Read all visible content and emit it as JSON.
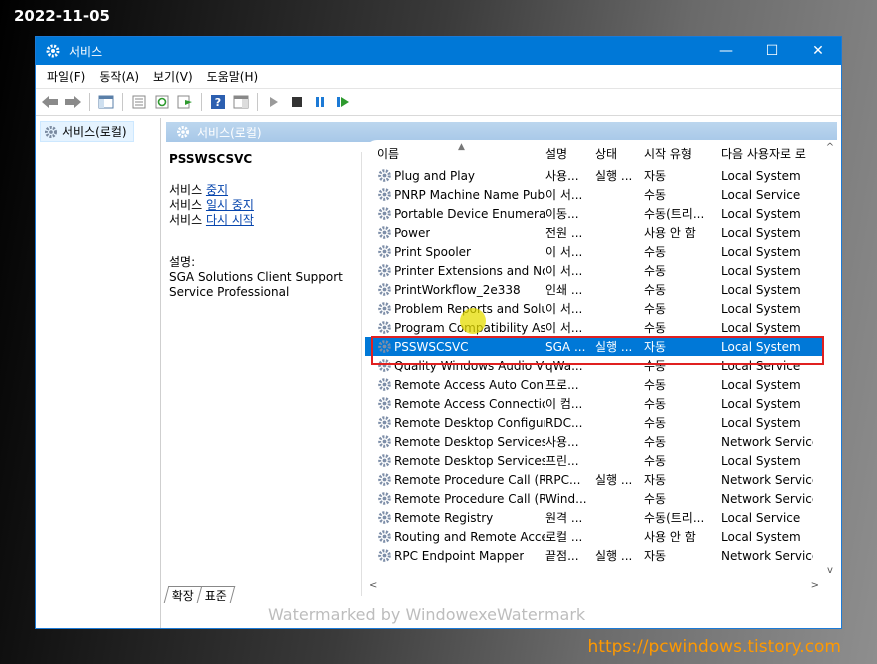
{
  "date_stamp": "2022-11-05",
  "site_url": "https://pcwindows.tistory.com",
  "watermark": "Watermarked by WindowexeWatermark",
  "window": {
    "title": "서비스",
    "controls": {
      "minimize": "—",
      "maximize": "☐",
      "close": "✕"
    }
  },
  "menu": [
    "파일(F)",
    "동작(A)",
    "보기(V)",
    "도움말(H)"
  ],
  "tree": {
    "root_label": "서비스(로컬)"
  },
  "pane": {
    "header": "서비스(로컬)",
    "selected_service": "PSSWSCSVC",
    "actions": [
      {
        "prefix": "서비스 ",
        "link": "중지"
      },
      {
        "prefix": "서비스 ",
        "link": "일시 중지"
      },
      {
        "prefix": "서비스 ",
        "link": "다시 시작"
      }
    ],
    "desc_label": "설명:",
    "desc_lines": [
      "SGA Solutions Client Support",
      "Service Professional"
    ]
  },
  "columns": {
    "name": "이름",
    "desc": "설명",
    "status": "상태",
    "start": "시작 유형",
    "logon": "다음 사용자로 로"
  },
  "rows": [
    {
      "name": "Plug and Play",
      "desc": "사용...",
      "status": "실행 ...",
      "start": "자동",
      "logon": "Local System"
    },
    {
      "name": "PNRP Machine Name Publi...",
      "desc": "이 서...",
      "status": "",
      "start": "수동",
      "logon": "Local Service"
    },
    {
      "name": "Portable Device Enumerato...",
      "desc": "이동...",
      "status": "",
      "start": "수동(트리...",
      "logon": "Local System"
    },
    {
      "name": "Power",
      "desc": "전원 ...",
      "status": "",
      "start": "사용 안 함",
      "logon": "Local System"
    },
    {
      "name": "Print Spooler",
      "desc": "이 서...",
      "status": "",
      "start": "수동",
      "logon": "Local System"
    },
    {
      "name": "Printer Extensions and Noti...",
      "desc": "이 서...",
      "status": "",
      "start": "수동",
      "logon": "Local System"
    },
    {
      "name": "PrintWorkflow_2e338",
      "desc": "인쇄 ...",
      "status": "",
      "start": "수동",
      "logon": "Local System"
    },
    {
      "name": "Problem Reports and Solut...",
      "desc": "이 서...",
      "status": "",
      "start": "수동",
      "logon": "Local System"
    },
    {
      "name": "Program Compatibility Assi...",
      "desc": "이 서...",
      "status": "",
      "start": "수동",
      "logon": "Local System"
    },
    {
      "name": "PSSWSCSVC",
      "desc": "SGA ...",
      "status": "실행 ...",
      "start": "자동",
      "logon": "Local System",
      "selected": true
    },
    {
      "name": "Quality Windows Audio Vi...",
      "desc": "qWa...",
      "status": "",
      "start": "수동",
      "logon": "Local Service"
    },
    {
      "name": "Remote Access Auto Conn...",
      "desc": "프로...",
      "status": "",
      "start": "수동",
      "logon": "Local System"
    },
    {
      "name": "Remote Access Connection...",
      "desc": "이 컴...",
      "status": "",
      "start": "수동",
      "logon": "Local System"
    },
    {
      "name": "Remote Desktop Configura...",
      "desc": "RDC...",
      "status": "",
      "start": "수동",
      "logon": "Local System"
    },
    {
      "name": "Remote Desktop Services",
      "desc": "사용...",
      "status": "",
      "start": "수동",
      "logon": "Network Service"
    },
    {
      "name": "Remote Desktop Services ...",
      "desc": "프린...",
      "status": "",
      "start": "수동",
      "logon": "Local System"
    },
    {
      "name": "Remote Procedure Call (RP...",
      "desc": "RPC...",
      "status": "실행 ...",
      "start": "자동",
      "logon": "Network Service"
    },
    {
      "name": "Remote Procedure Call (RP...",
      "desc": "Wind...",
      "status": "",
      "start": "수동",
      "logon": "Network Service"
    },
    {
      "name": "Remote Registry",
      "desc": "원격 ...",
      "status": "",
      "start": "수동(트리...",
      "logon": "Local Service"
    },
    {
      "name": "Routing and Remote Access",
      "desc": "로컬 ...",
      "status": "",
      "start": "사용 안 함",
      "logon": "Local System"
    },
    {
      "name": "RPC Endpoint Mapper",
      "desc": "끝점...",
      "status": "실행 ...",
      "start": "자동",
      "logon": "Network Service"
    }
  ],
  "tabs": [
    "확장",
    "표준"
  ],
  "colors": {
    "titlebar": "#0078d7",
    "selection": "#0078d7",
    "highlight_box": "#e02020",
    "url": "#ff9900"
  }
}
